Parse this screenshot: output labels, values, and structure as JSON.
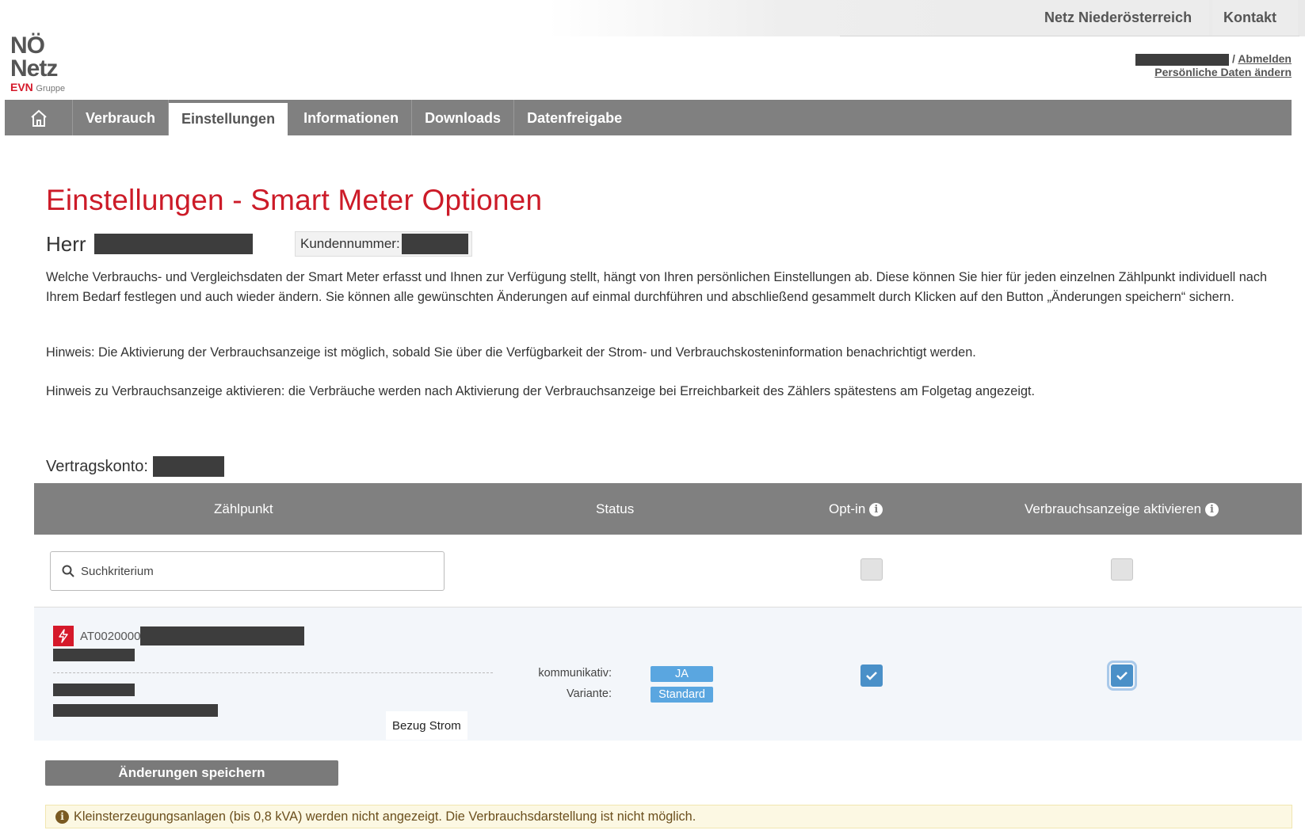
{
  "header": {
    "links": {
      "netz": "Netz Niederösterreich",
      "kontakt": "Kontakt"
    },
    "logo": {
      "line1": "NÖ",
      "line2": "Netz",
      "brand": "EVN",
      "group": "Gruppe"
    },
    "user": {
      "logout": "Abmelden",
      "separator": " / ",
      "edit_profile": "Persönliche Daten ändern"
    }
  },
  "nav": {
    "home_icon": "home-icon",
    "items": [
      {
        "label": "Verbrauch"
      },
      {
        "label": "Einstellungen",
        "active": true
      },
      {
        "label": "Informationen"
      },
      {
        "label": "Downloads"
      },
      {
        "label": "Datenfreigabe"
      }
    ]
  },
  "page": {
    "title": "Einstellungen - Smart Meter Optionen",
    "salutation": "Herr",
    "customer_number_label": "Kundennummer:",
    "intro": "Welche Verbrauchs- und Vergleichsdaten der Smart Meter erfasst und Ihnen zur Verfügung stellt, hängt von Ihren persönlichen Einstellungen ab. Diese können Sie hier für jeden einzelnen Zählpunkt individuell nach Ihrem Bedarf festlegen und auch wieder ändern. Sie können alle gewünschten Änderungen auf einmal durchführen und abschließend gesammelt durch Klicken auf den Button „Änderungen speichern“ sichern.",
    "hint1": "Hinweis: Die Aktivierung der Verbrauchsanzeige ist möglich, sobald Sie über die Verfügbarkeit der Strom- und Verbrauchskosteninformation benachrichtigt werden.",
    "hint2": "Hinweis zu Verbrauchsanzeige aktivieren: die Verbräuche werden nach Aktivierung der Verbrauchsanzeige bei Erreichbarkeit des Zählers spätestens am Folgetag angezeigt.",
    "contract_label": "Vertragskonto:"
  },
  "table": {
    "headers": {
      "zaehlpunkt": "Zählpunkt",
      "status": "Status",
      "optin": "Opt-in",
      "verbrauchsanzeige": "Verbrauchsanzeige aktivieren"
    },
    "search_placeholder": "Suchkriterium",
    "filter_optin_checked": false,
    "filter_anzeige_checked": false,
    "rows": [
      {
        "id_prefix": "AT0020000",
        "type": "Bezug Strom",
        "status_kommunikativ_label": "kommunikativ:",
        "status_kommunikativ_value": "JA",
        "status_variante_label": "Variante:",
        "status_variante_value": "Standard",
        "optin_checked": true,
        "anzeige_checked": true
      }
    ]
  },
  "actions": {
    "save": "Änderungen speichern"
  },
  "notice": "Kleinsterzeugungsanlagen (bis 0,8 kVA) werden nicht angezeigt. Die Verbrauchsdarstellung ist nicht möglich.",
  "colors": {
    "brand_red": "#cc1b28",
    "nav_gray": "#808080",
    "badge_blue": "#5aa6e0",
    "check_blue": "#4a90c8"
  }
}
